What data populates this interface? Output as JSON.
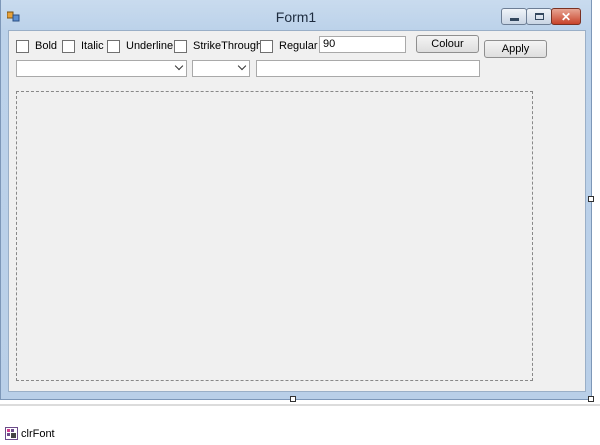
{
  "form": {
    "title": "Form1"
  },
  "checkboxes": [
    {
      "label": "Bold",
      "checked": false
    },
    {
      "label": "Italic",
      "checked": false
    },
    {
      "label": "Underline",
      "checked": false
    },
    {
      "label": "StrikeThrough",
      "checked": false
    },
    {
      "label": "Regular",
      "checked": false
    }
  ],
  "size_field": {
    "value": "90"
  },
  "colour_button": {
    "label": "Colour"
  },
  "apply_button": {
    "label": "Apply"
  },
  "font_combo": {
    "value": ""
  },
  "size_combo": {
    "value": ""
  },
  "text_field": {
    "value": ""
  },
  "component_tray": {
    "items": [
      {
        "label": "clrFont",
        "icon": "color-dialog-icon"
      }
    ]
  },
  "colors": {
    "close_button": "#c8432a",
    "form_frame": "#bcd2ea"
  }
}
